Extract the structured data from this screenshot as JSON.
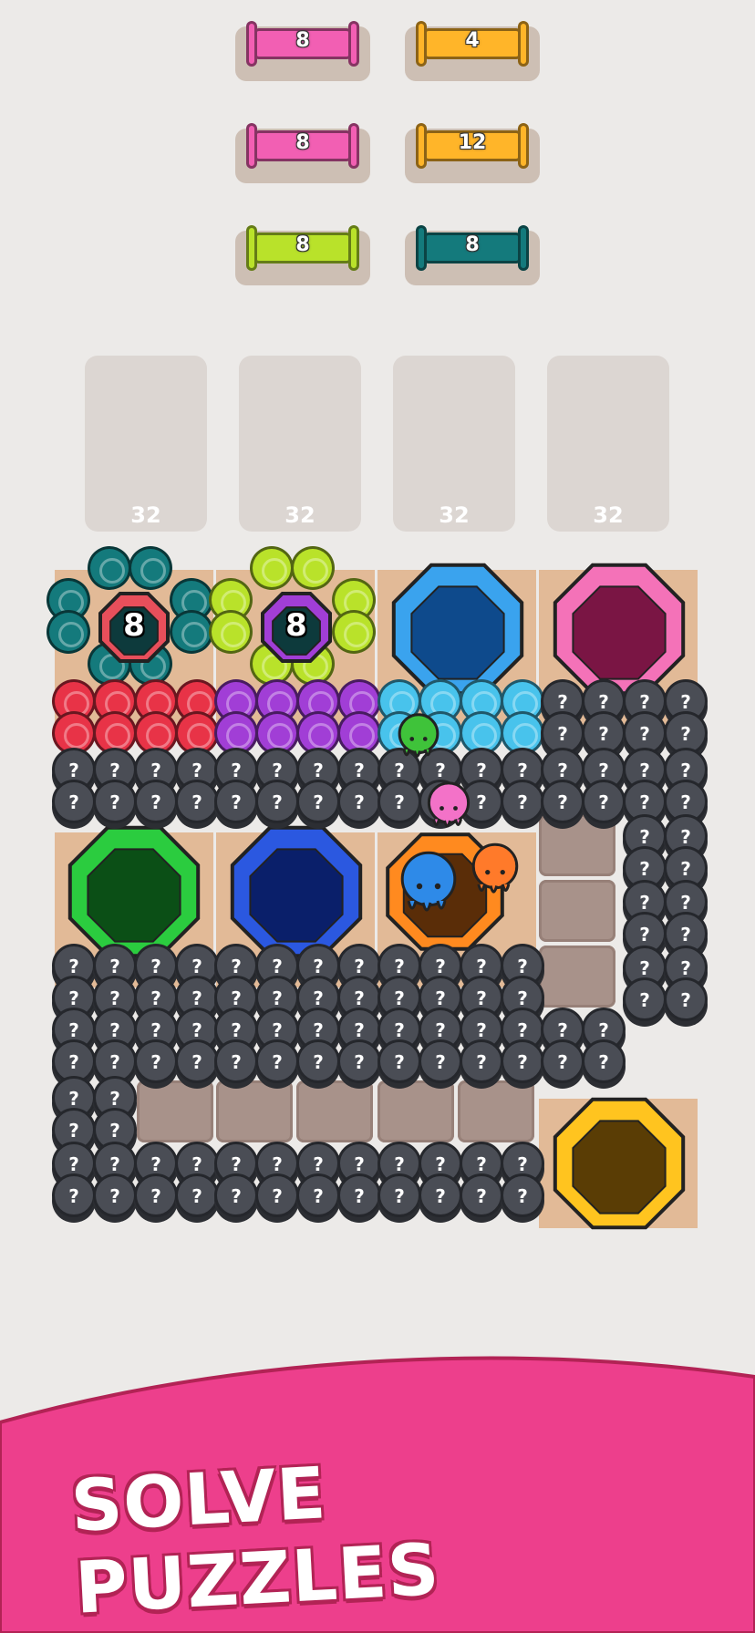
{
  "colors": {
    "background": "#eceae8",
    "pink": "#f25fb3",
    "orange": "#ffb529",
    "lime": "#b9e22a",
    "teal": "#147a7c",
    "red": "#e83347",
    "purple": "#a13ed6",
    "cyan": "#48c3ec",
    "banner": "#ed3f8c"
  },
  "spools": [
    {
      "count": "8",
      "color": "pink"
    },
    {
      "count": "4",
      "color": "orange"
    },
    {
      "count": "8",
      "color": "pink"
    },
    {
      "count": "12",
      "color": "orange"
    },
    {
      "count": "8",
      "color": "lime"
    },
    {
      "count": "8",
      "color": "teal"
    }
  ],
  "holding_slots": [
    {
      "capacity": "32"
    },
    {
      "capacity": "32"
    },
    {
      "capacity": "32"
    },
    {
      "capacity": "32"
    }
  ],
  "locked_holes": [
    {
      "count": "8",
      "color": "teal"
    },
    {
      "count": "8",
      "color": "lime"
    }
  ],
  "holes": [
    {
      "color": "blue"
    },
    {
      "color": "pink"
    },
    {
      "color": "green"
    },
    {
      "color": "royal-blue"
    },
    {
      "color": "orange"
    },
    {
      "color": "yellow"
    }
  ],
  "mystery_symbol": "?",
  "banner": {
    "text": "SOLVE PUZZLES"
  }
}
